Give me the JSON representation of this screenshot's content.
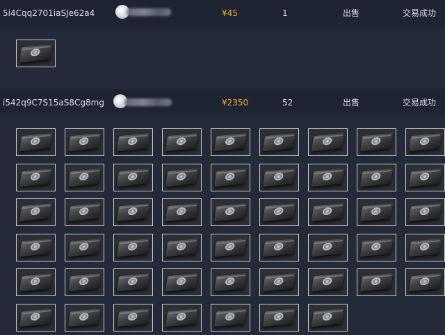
{
  "rows": [
    {
      "name": "5i4Cqq2701iaSJe62a4",
      "price": "¥45",
      "count": "1",
      "type": "出售",
      "status": "交易成功",
      "item_count": 1,
      "item_icon": "weapon-case-icon"
    },
    {
      "name": "i542q9C7S15aS8Cg8mg",
      "price": "¥2350",
      "count": "52",
      "type": "出售",
      "status": "交易成功",
      "item_count": 52,
      "item_icon": "weapon-case-icon"
    }
  ],
  "colors": {
    "background": "#252a3a",
    "row_background": "#1f2433",
    "price": "#f0a52e",
    "text": "#d9dde6"
  }
}
